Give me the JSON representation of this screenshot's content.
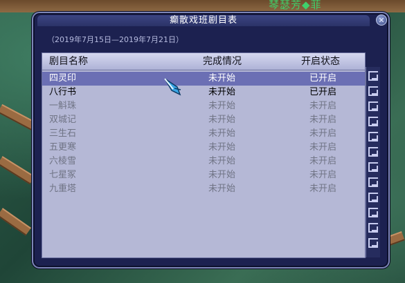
{
  "background": {
    "character_name": "琴瑟芳◆菲"
  },
  "window": {
    "title": "癫散戏班剧目表",
    "date_range": "（2019年7月15日—2019年7月21日）",
    "close_label": "✕"
  },
  "table": {
    "headers": {
      "name": "剧目名称",
      "completion": "完成情况",
      "status": "开启状态"
    },
    "rows": [
      {
        "name": "四灵印",
        "completion": "未开始",
        "status": "已开启",
        "state": "selected"
      },
      {
        "name": "八行书",
        "completion": "未开始",
        "status": "已开启",
        "state": "on"
      },
      {
        "name": "一斛珠",
        "completion": "未开始",
        "status": "未开启",
        "state": "off"
      },
      {
        "name": "双城记",
        "completion": "未开始",
        "status": "未开启",
        "state": "off"
      },
      {
        "name": "三生石",
        "completion": "未开始",
        "status": "未开启",
        "state": "off"
      },
      {
        "name": "五更寒",
        "completion": "未开始",
        "status": "未开启",
        "state": "off"
      },
      {
        "name": "六棱雪",
        "completion": "未开始",
        "status": "未开启",
        "state": "off"
      },
      {
        "name": "七星冢",
        "completion": "未开始",
        "status": "未开启",
        "state": "off"
      },
      {
        "name": "九重塔",
        "completion": "未开始",
        "status": "未开启",
        "state": "off"
      }
    ]
  },
  "colors": {
    "window_bg": "#1c2150",
    "selected_row": "#6b6fb4",
    "panel_bg": "#b5b8d6"
  },
  "icons": {
    "close": "close-icon",
    "cursor": "feather-cursor-icon",
    "decor": "greek-key-border-icon"
  }
}
